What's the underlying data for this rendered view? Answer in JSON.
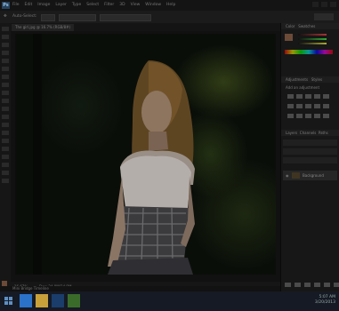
{
  "app": {
    "logo_text": "Ps",
    "menu": [
      "File",
      "Edit",
      "Image",
      "Layer",
      "Type",
      "Select",
      "Filter",
      "3D",
      "View",
      "Window",
      "Help"
    ],
    "options_label": "Auto-Select:",
    "workspace": "Essentials"
  },
  "document": {
    "tab_label": "The girl.jpg @ 16.7% (RGB/8#)",
    "status_zoom": "16.67%",
    "status_doc": "Doc: 24.9M/24.9M",
    "timeline_label": "Mini Bridge   Timeline"
  },
  "panels": {
    "color_tab": "Color",
    "swatches_tab": "Swatches",
    "adjustments_tab": "Adjustments",
    "styles_tab": "Styles",
    "adjustments_hint": "Add an adjustment",
    "layers_tab": "Layers",
    "channels_tab": "Channels",
    "paths_tab": "Paths",
    "layer_name": "Background"
  },
  "taskbar": {
    "time": "5:07 AM",
    "date": "3/20/2013"
  },
  "colors": {
    "fg_color": "#6b4a38",
    "accent_ps": "#27445e",
    "taskbar_ie": "#2a73c9",
    "taskbar_explorer": "#c9a13a",
    "taskbar_ps": "#1b3d6b",
    "taskbar_other": "#3b6b2a"
  }
}
